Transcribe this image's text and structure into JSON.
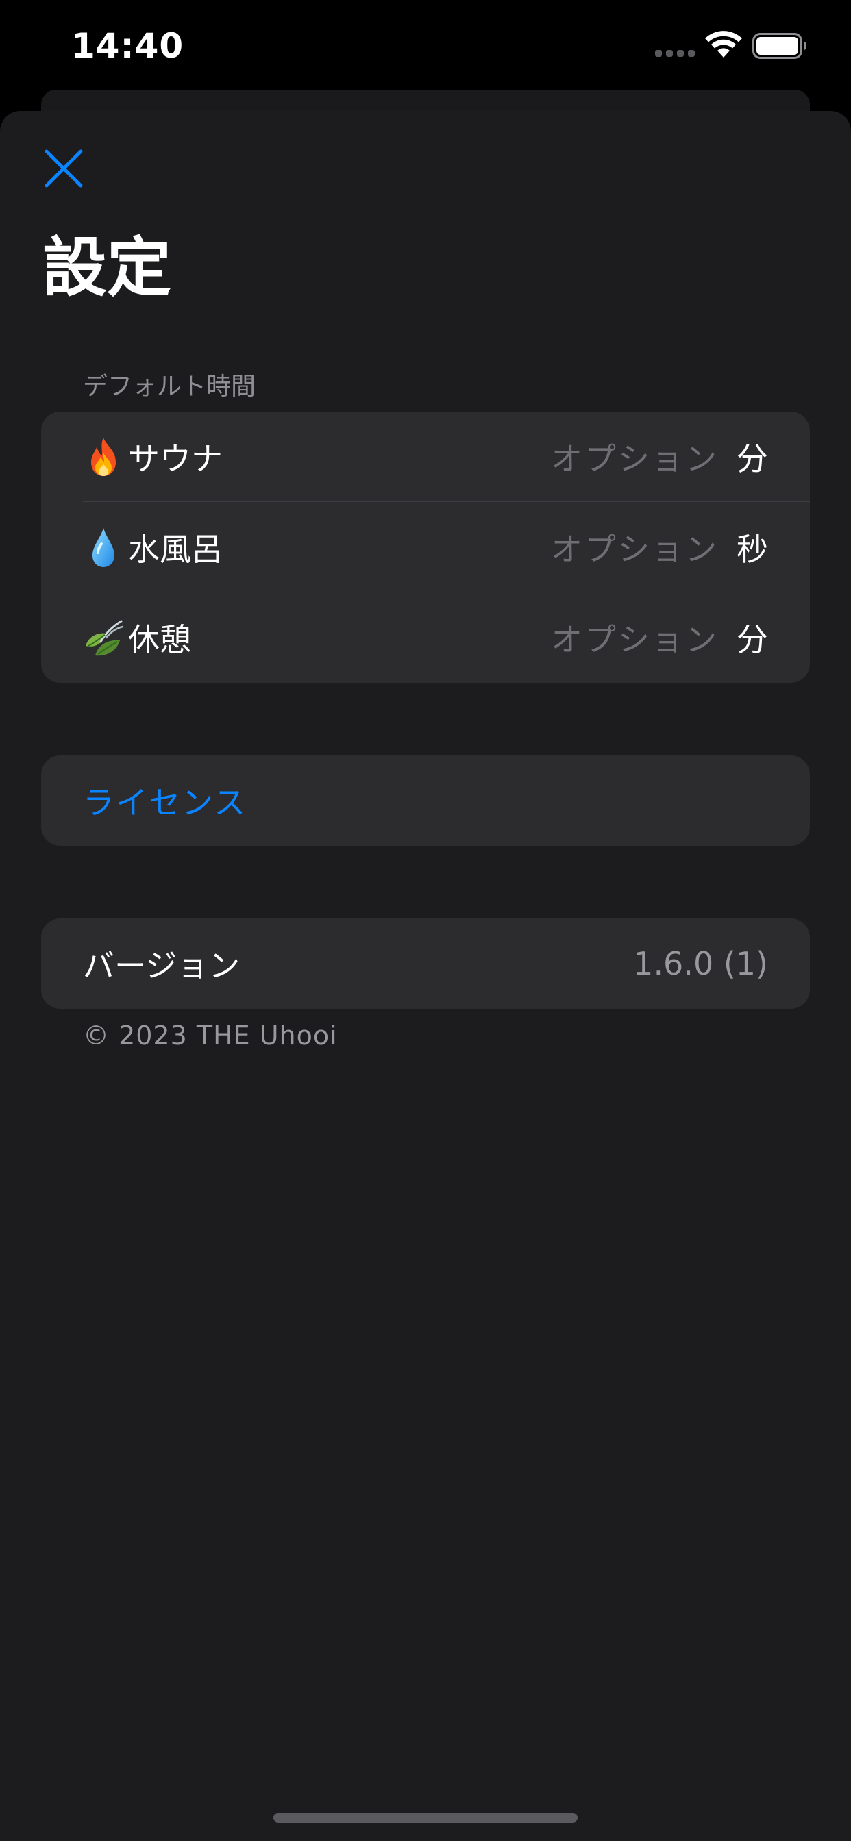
{
  "status_bar": {
    "time": "14:40"
  },
  "header": {
    "title": "設定",
    "close_icon": "close-icon"
  },
  "default_time": {
    "header": "デフォルト時間",
    "rows": [
      {
        "icon": "fire-icon",
        "label": "サウナ",
        "placeholder": "オプション",
        "unit": "分"
      },
      {
        "icon": "droplet-icon",
        "label": "水風呂",
        "placeholder": "オプション",
        "unit": "秒"
      },
      {
        "icon": "leaf-icon",
        "label": "休憩",
        "placeholder": "オプション",
        "unit": "分"
      }
    ]
  },
  "license": {
    "label": "ライセンス"
  },
  "version": {
    "label": "バージョン",
    "value": "1.6.0 (1)"
  },
  "footer": {
    "copyright": "© 2023 THE Uhooi"
  },
  "colors": {
    "accent": "#0a84ff",
    "background": "#1c1c1e",
    "cell": "#2c2c2e",
    "secondary_text": "#8e8e93"
  }
}
